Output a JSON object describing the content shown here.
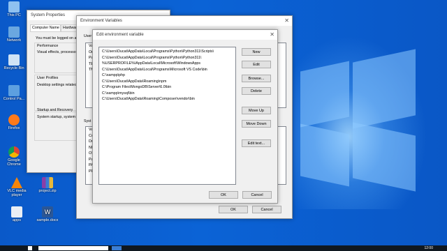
{
  "desktop_icons": [
    {
      "label": "This PC"
    },
    {
      "label": "Network"
    },
    {
      "label": "Recycle Bin"
    },
    {
      "label": "Control Pa..."
    },
    {
      "label": "Firefox"
    },
    {
      "label": "Google Chrome"
    },
    {
      "label": "VLC media player"
    },
    {
      "label": "project.zip"
    },
    {
      "label": "apps"
    },
    {
      "label": "sample.docx"
    }
  ],
  "system_properties": {
    "title": "System Properties",
    "tabs": [
      "Computer Name",
      "Hardware"
    ],
    "logged_on": "You must be logged on as",
    "performance": "Performance",
    "performance_desc": "Visual effects, processor",
    "user_profiles": "User Profiles",
    "user_profiles_desc": "Desktop settings related",
    "startup": "Startup and Recovery",
    "startup_desc": "System startup, system f"
  },
  "env_vars": {
    "title": "Environment Variables",
    "user_label": "User",
    "sys_label": "Syst",
    "user_rows": [
      "Va",
      "On",
      "Pa",
      "TE",
      "TM"
    ],
    "sys_rows": [
      "Va",
      "Co",
      "Dr",
      "NI",
      "OS",
      "Pa",
      "PA",
      "PR"
    ],
    "ok": "OK",
    "cancel": "Cancel"
  },
  "edit_env": {
    "title": "Edit environment variable",
    "paths": [
      "C:\\Users\\Ducat\\AppData\\Local\\Programs\\Python\\Python311\\Scripts\\",
      "C:\\Users\\Ducat\\AppData\\Local\\Programs\\Python\\Python311\\",
      "%USERPROFILE%\\AppData\\Local\\Microsoft\\WindowsApps",
      "C:\\Users\\Ducat\\AppData\\Local\\Programs\\Microsoft VS Code\\bin",
      "C:\\xampp\\php",
      "C:\\Users\\Ducat\\AppData\\Roaming\\npm",
      "C:\\Program Files\\MongoDB\\Server\\6.0\\bin",
      "C:\\xampp\\mysql\\bin",
      "C:\\Users\\Ducat\\AppData\\Roaming\\Composer\\vendor\\bin"
    ],
    "buttons": {
      "new": "New",
      "edit": "Edit",
      "browse": "Browse...",
      "delete": "Delete",
      "move_up": "Move Up",
      "move_down": "Move Down",
      "edit_text": "Edit text...",
      "ok": "OK",
      "cancel": "Cancel"
    }
  },
  "taskbar": {
    "time": "12:00"
  }
}
